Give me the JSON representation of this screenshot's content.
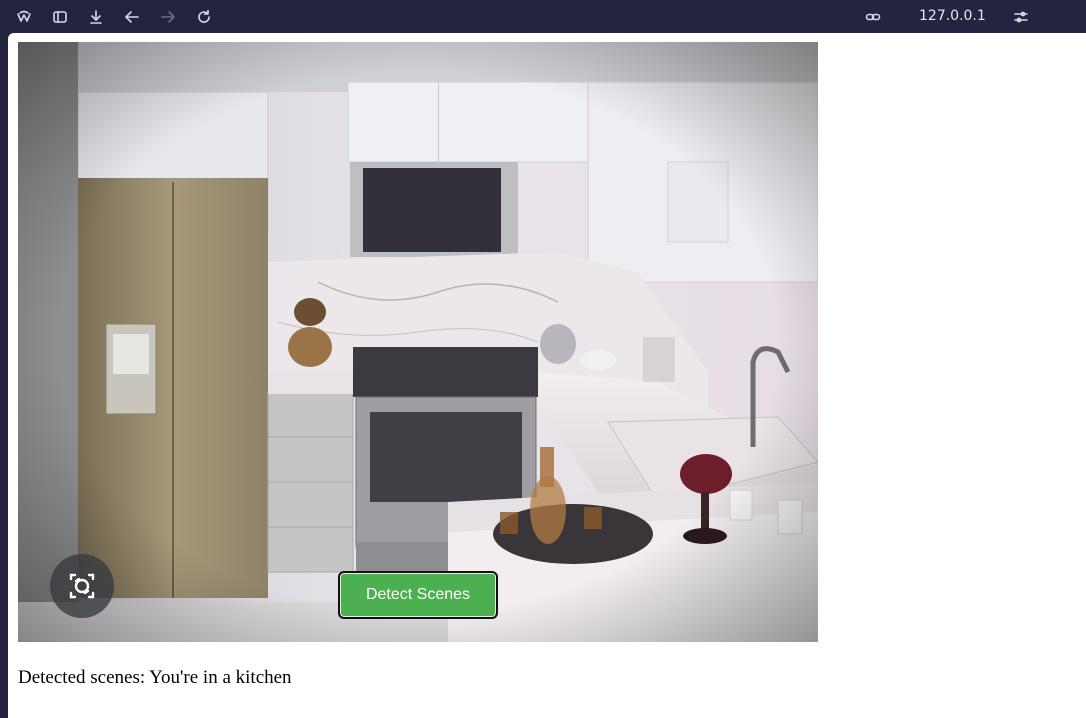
{
  "browser": {
    "url": "127.0.0.1",
    "icons": [
      "app-logo-icon",
      "sidebar-icon",
      "download-icon",
      "back-icon",
      "forward-icon",
      "reload-icon",
      "link-icon",
      "site-settings-icon"
    ]
  },
  "camera": {
    "scene": "kitchen",
    "switch_icon": "switch-camera-icon"
  },
  "actions": {
    "detect_label": "Detect Scenes"
  },
  "result": {
    "text": "Detected scenes: You're in a kitchen"
  },
  "colors": {
    "toolbar_bg": "#23243f",
    "button_green": "#4caf50"
  }
}
